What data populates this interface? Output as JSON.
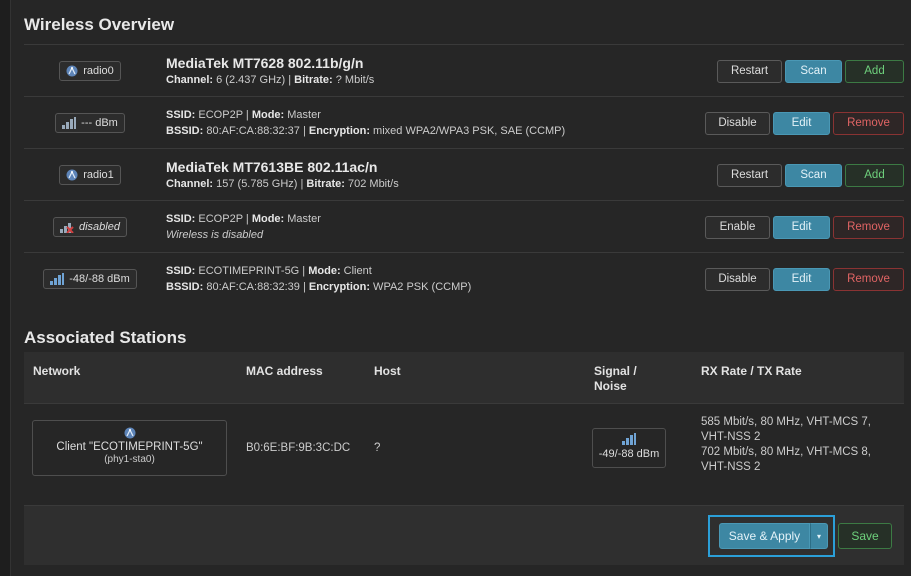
{
  "headings": {
    "wireless": "Wireless Overview",
    "stations": "Associated Stations"
  },
  "rows": [
    {
      "badge_text": "radio0",
      "badge_icon": "radio-antenna-icon",
      "title": "MediaTek MT7628 802.11b/g/n",
      "l1_k1": "Channel:",
      "l1_v1": " 6 (2.437 GHz) | ",
      "l1_k2": "Bitrate:",
      "l1_v2": " ? Mbit/s",
      "buttons": [
        "Restart",
        "Scan",
        "Add"
      ]
    },
    {
      "badge_text": "--- dBm",
      "badge_icon": "signal-bars-icon",
      "l1_k1": "SSID:",
      "l1_v1": " ECOP2P | ",
      "l1_k2": "Mode:",
      "l1_v2": " Master",
      "l2_k1": "BSSID:",
      "l2_v1": " 80:AF:CA:88:32:37 | ",
      "l2_k2": "Encryption:",
      "l2_v2": " mixed WPA2/WPA3 PSK, SAE (CCMP)",
      "buttons": [
        "Disable",
        "Edit",
        "Remove"
      ]
    },
    {
      "badge_text": "radio1",
      "badge_icon": "radio-antenna-icon",
      "title": "MediaTek MT7613BE 802.11ac/n",
      "l1_k1": "Channel:",
      "l1_v1": " 157 (5.785 GHz) | ",
      "l1_k2": "Bitrate:",
      "l1_v2": " 702 Mbit/s",
      "buttons": [
        "Restart",
        "Scan",
        "Add"
      ]
    },
    {
      "badge_text": "disabled",
      "badge_icon": "signal-disabled-icon",
      "l1_k1": "SSID:",
      "l1_v1": " ECOP2P | ",
      "l1_k2": "Mode:",
      "l1_v2": " Master",
      "l2_italic": "Wireless is disabled",
      "buttons": [
        "Enable",
        "Edit",
        "Remove"
      ]
    },
    {
      "badge_text": "-48/-88 dBm",
      "badge_icon": "signal-bars-icon",
      "l1_k1": "SSID:",
      "l1_v1": " ECOTIMEPRINT-5G | ",
      "l1_k2": "Mode:",
      "l1_v2": " Client",
      "l2_k1": "BSSID:",
      "l2_v1": " 80:AF:CA:88:32:39 | ",
      "l2_k2": "Encryption:",
      "l2_v2": " WPA2 PSK (CCMP)",
      "buttons": [
        "Disable",
        "Edit",
        "Remove"
      ]
    }
  ],
  "table": {
    "columns": [
      "Network",
      "MAC address",
      "Host",
      "Signal /",
      "Noise",
      "RX Rate / TX Rate"
    ],
    "row": {
      "network_name": "Client \"ECOTIMEPRINT-5G\"",
      "network_iface": "(phy1-sta0)",
      "mac": "B0:6E:BF:9B:3C:DC",
      "host": "?",
      "signal": "-49/-88 dBm",
      "rx1": "585 Mbit/s, 80 MHz, VHT-MCS 7,",
      "rx2": "VHT-NSS 2",
      "tx1": "702 Mbit/s, 80 MHz, VHT-MCS 8,",
      "tx2": "VHT-NSS 2"
    }
  },
  "footer": {
    "save_apply": "Save & Apply",
    "save": "Save",
    "dropdown_glyph": "▾"
  },
  "colors": {
    "primary": "#3d87a3",
    "positive": "#6ed07c",
    "negative": "#e06464",
    "focus": "#2b9fd8"
  }
}
